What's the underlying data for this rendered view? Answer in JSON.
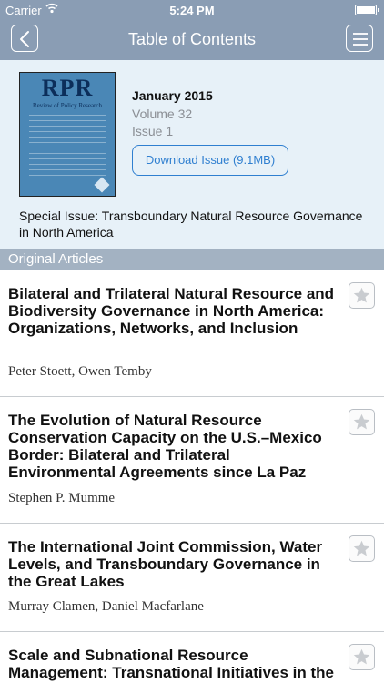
{
  "status_bar": {
    "carrier": "Carrier",
    "time": "5:24 PM"
  },
  "nav": {
    "title": "Table of Contents"
  },
  "issue": {
    "cover_logo": "RPR",
    "cover_subtitle": "Review of Policy Research",
    "date": "January 2015",
    "volume": "Volume 32",
    "issue": "Issue 1",
    "download_label": "Download Issue (9.1MB)",
    "special": "Special Issue: Transboundary Natural Resource Governance in North America"
  },
  "section": {
    "title": "Original Articles"
  },
  "articles": [
    {
      "title": "Bilateral and Trilateral Natural Resource and Biodiversity Governance in North America: Organizations, Networks, and Inclusion",
      "authors": "Peter Stoett, Owen Temby"
    },
    {
      "title": "The Evolution of Natural Resource Conservation Capacity on the U.S.–Mexico Border: Bilateral and Trilateral Environmental Agreements since La Paz",
      "authors": "Stephen P. Mumme"
    },
    {
      "title": "The International Joint Commission, Water Levels, and Transboundary Governance in the Great Lakes",
      "authors": "Murray Clamen, Daniel Macfarlane"
    },
    {
      "title": "Scale and Subnational Resource Management: Transnational Initiatives in the Salish Sea Region",
      "authors": ""
    }
  ]
}
